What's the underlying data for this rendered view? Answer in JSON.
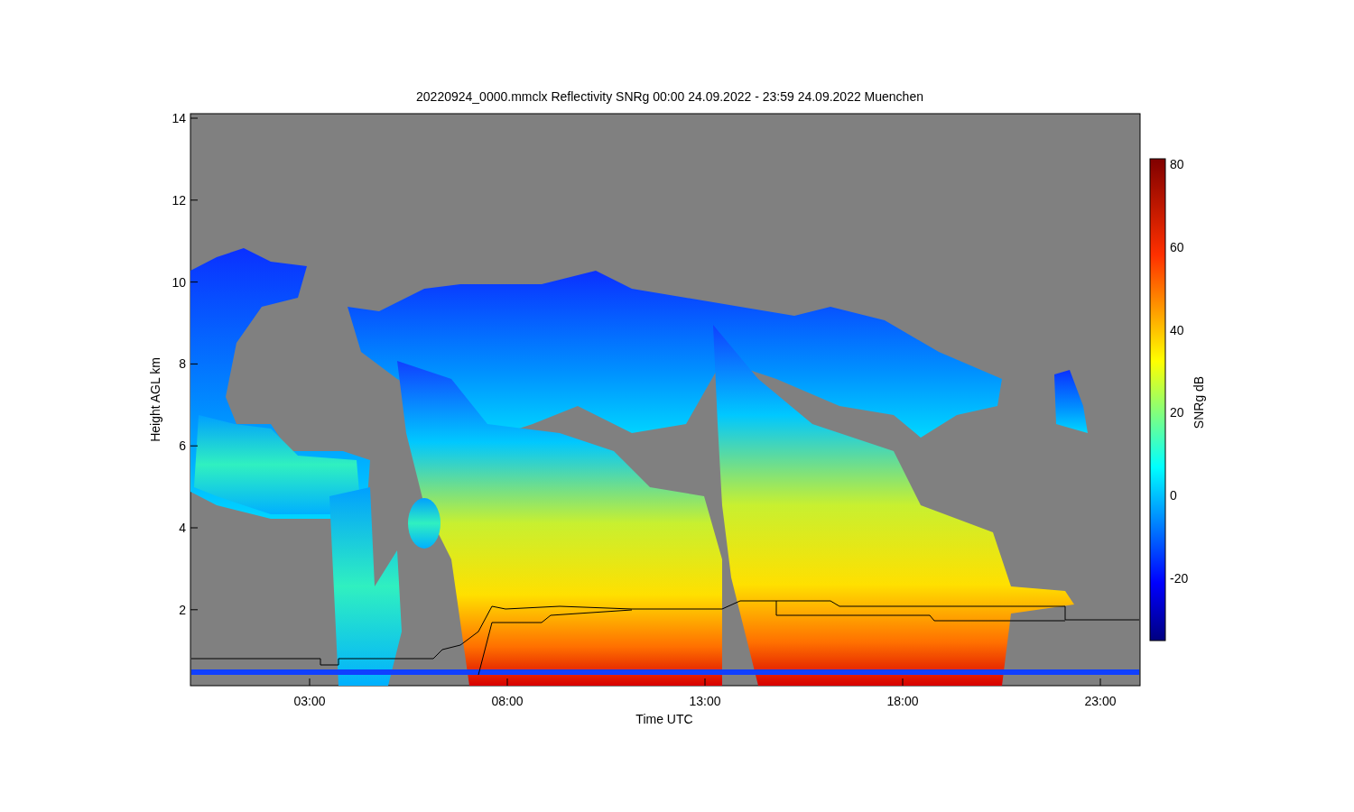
{
  "title": "20220924_0000.mmclx Reflectivity SNRg   00:00 24.09.2022 - 23:59 24.09.2022 Muenchen",
  "y_axis": {
    "label": "Height AGL km",
    "ticks": [
      "14",
      "12",
      "10",
      "8",
      "6",
      "4",
      "2"
    ]
  },
  "x_axis": {
    "label": "Time UTC",
    "ticks": [
      "03:00",
      "08:00",
      "13:00",
      "18:00",
      "23:00"
    ]
  },
  "colorbar": {
    "label": "SNRg dB",
    "ticks": [
      "80",
      "60",
      "40",
      "20",
      "0",
      "-20"
    ]
  }
}
